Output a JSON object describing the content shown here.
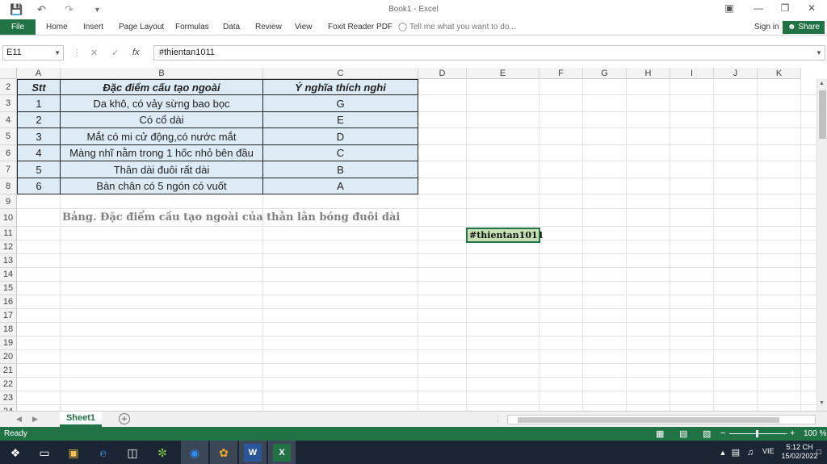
{
  "window": {
    "title": "Book1 - Excel"
  },
  "ribbon": {
    "file": "File",
    "tabs": [
      "Home",
      "Insert",
      "Page Layout",
      "Formulas",
      "Data",
      "Review",
      "View",
      "Foxit Reader PDF"
    ],
    "tell_me": "Tell me what you want to do...",
    "sign_in": "Sign in",
    "share": "Share"
  },
  "formula_bar": {
    "name_box": "E11",
    "fx": "fx",
    "content": "#thientan1011"
  },
  "columns": [
    "A",
    "B",
    "C",
    "D",
    "E",
    "F",
    "G",
    "H",
    "I",
    "J",
    "K"
  ],
  "rows": [
    "2",
    "3",
    "4",
    "5",
    "6",
    "7",
    "8",
    "9",
    "10",
    "11",
    "12",
    "13",
    "14",
    "15",
    "16",
    "17",
    "18",
    "19",
    "20",
    "21",
    "22",
    "23",
    "24"
  ],
  "table": {
    "headers": [
      "Stt",
      "Đặc điểm cấu tạo ngoài",
      "Ý nghĩa thích nghi"
    ],
    "rows": [
      [
        "1",
        "Da khô, có vảy sừng bao bọc",
        "G"
      ],
      [
        "2",
        "Có cổ dài",
        "E"
      ],
      [
        "3",
        "Mắt có mi cử động,có nước mắt",
        "D"
      ],
      [
        "4",
        "Màng nhĩ nằm trong 1 hốc nhỏ bên đầu",
        "C"
      ],
      [
        "5",
        "Thân dài đuôi rất dài",
        "B"
      ],
      [
        "6",
        "Bàn chân có 5 ngón có vuốt",
        "A"
      ]
    ]
  },
  "caption": "Bảng. Đặc điểm cấu tạo ngoài của thằn lằn bóng đuôi dài",
  "tag_cell": "#thientan1011",
  "sheet_tab": "Sheet1",
  "status": {
    "ready": "Ready",
    "zoom": "100 %"
  },
  "taskbar": {
    "lang": "VIE",
    "time": "5:12 CH",
    "date": "15/02/2022"
  },
  "colors": {
    "excel_green": "#217346",
    "table_fill": "#ddebf7",
    "tag_fill": "#c6e0b4"
  }
}
